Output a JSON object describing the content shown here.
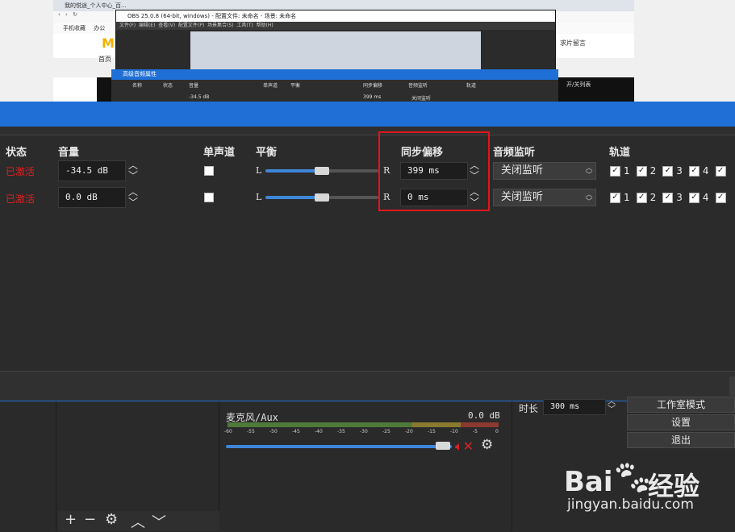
{
  "preview": {
    "browser_tab": "我的悦途_个人中心_百...",
    "obs_title": "OBS 25.0.8 (64-bit, windows) - 配置文件: 未命名 - 场景: 未命名",
    "obs_menu": [
      "文件(F)",
      "编辑(E)",
      "查看(V)",
      "配置文件(P)",
      "场景集合(S)",
      "工具(T)",
      "帮助(H)"
    ],
    "bookmarks": [
      "手机收藏",
      "办公"
    ],
    "site_nav": "首页",
    "site_right": "求片留言",
    "site_right2": "开/关列表",
    "mini_dialog_title": "高级音频属性",
    "mini_headers": [
      "名称",
      "状态",
      "音量",
      "单声道",
      "平衡",
      "同步偏移",
      "音频监听",
      "轨道"
    ],
    "mini_row": "-34.5 dB",
    "mini_offset": "399 ms",
    "mini_monitor": "关闭监听"
  },
  "dialog": {
    "headers": {
      "status": "状态",
      "volume": "音量",
      "mono": "单声道",
      "balance": "平衡",
      "sync_offset": "同步偏移",
      "monitoring": "音频监听",
      "tracks": "轨道"
    },
    "rows": [
      {
        "status": "已激活",
        "volume": "-34.5 dB",
        "balance_left": "L",
        "balance_right": "R",
        "offset": "399 ms",
        "monitoring": "关闭监听",
        "tracks": [
          "1",
          "2",
          "3",
          "4"
        ]
      },
      {
        "status": "已激活",
        "volume": "0.0 dB",
        "balance_left": "L",
        "balance_right": "R",
        "offset": "0 ms",
        "monitoring": "关闭监听",
        "tracks": [
          "1",
          "2",
          "3",
          "4"
        ]
      }
    ]
  },
  "mixer": {
    "name": "麦克风/Aux",
    "level": "0.0 dB",
    "scale": [
      "-60",
      "-55",
      "-50",
      "-45",
      "-40",
      "-35",
      "-30",
      "-25",
      "-20",
      "-15",
      "-10",
      "-5",
      "0"
    ],
    "volume_fraction": 1.0
  },
  "controls": {
    "duration_label": "时长",
    "duration_value": "300 ms",
    "studio_mode": "工作室模式",
    "settings": "设置",
    "exit": "退出"
  },
  "watermark": {
    "brand": "Bai",
    "brand2": "经验",
    "url": "jingyan.baidu.com"
  },
  "colors": {
    "accent": "#1f6fd6",
    "status_red": "#e02020",
    "highlight": "#e0161c"
  }
}
